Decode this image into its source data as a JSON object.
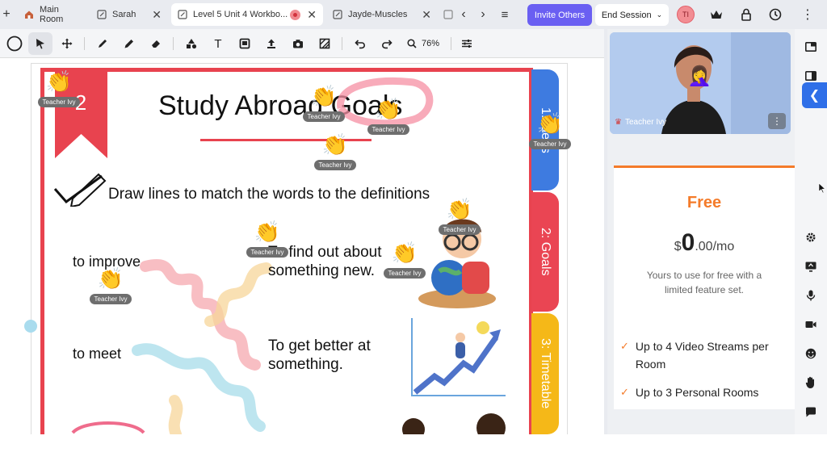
{
  "tabs": [
    {
      "label": "Main Room",
      "icon": "house-icon",
      "active": false
    },
    {
      "label": "Sarah",
      "icon": "edit-icon",
      "active": false
    },
    {
      "label": "Level 5 Unit 4 Workbo...",
      "icon": "edit-icon",
      "active": true
    },
    {
      "label": "Jayde-Muscles",
      "icon": "edit-icon",
      "active": false
    }
  ],
  "header": {
    "invite_label": "Invite Others",
    "end_session_label": "End Session",
    "avatar_initials": "TI"
  },
  "toolbar": {
    "zoom": "76%"
  },
  "worksheet": {
    "page_number": "2",
    "title": "Study Abroad Goals",
    "instruction": "Draw lines to match the words to the definitions",
    "word1": "to improve",
    "word2": "to meet",
    "def1_line1": "To find out about",
    "def1_line2": "something new.",
    "def2_line1": "To get better at",
    "def2_line2": "something.",
    "side_tabs": [
      "1: Ideas",
      "2: Goals",
      "3: Timetable"
    ]
  },
  "reactions": {
    "emoji": "👏",
    "label": "Teacher Ivy"
  },
  "video": {
    "participant_name": "Teacher Ivy",
    "avatar_emoji": "🤦‍♀️"
  },
  "plan": {
    "name": "Free",
    "currency": "$",
    "price_whole": "0",
    "price_fraction": ".00",
    "period": "/mo",
    "description": "Yours to use for free with a limited feature set.",
    "features": [
      "Up to 4 Video Streams per Room",
      "Up to 3 Personal Rooms"
    ]
  },
  "colors": {
    "accent": "#6a5ff2",
    "plan_orange": "#f47b2a",
    "frame_red": "#e8434f",
    "tab_blue": "#3e7be0",
    "tab_red": "#ea4553",
    "tab_yellow": "#f5b818"
  }
}
